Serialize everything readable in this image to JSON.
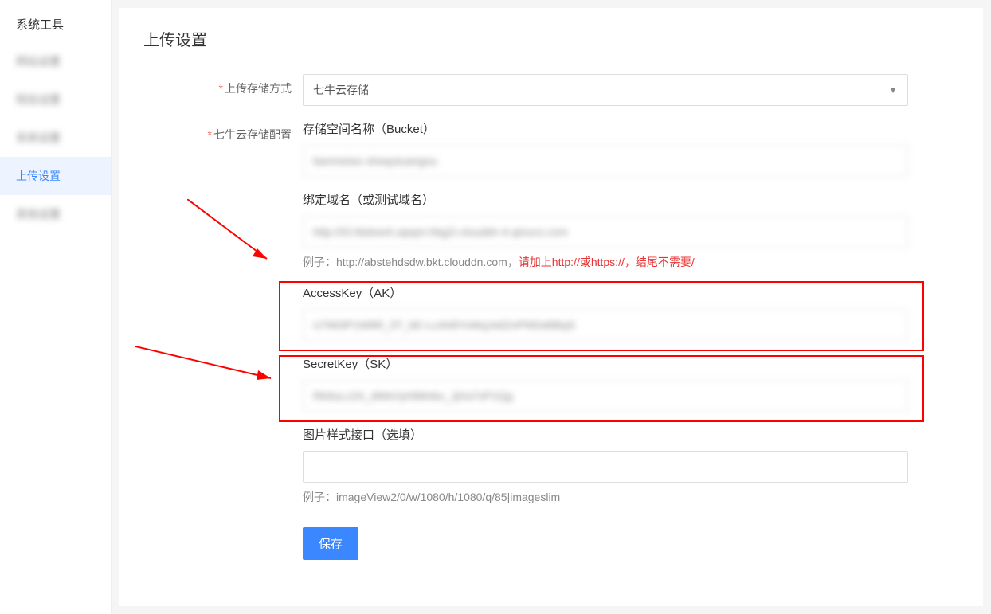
{
  "sidebar": {
    "header": "系统工具",
    "items": [
      {
        "label": "网站设置",
        "active": false,
        "blurred": true
      },
      {
        "label": "短信设置",
        "active": false,
        "blurred": true
      },
      {
        "label": "系统设置",
        "active": false,
        "blurred": true
      },
      {
        "label": "上传设置",
        "active": true,
        "blurred": false
      },
      {
        "label": "其他设置",
        "active": false,
        "blurred": true
      }
    ]
  },
  "page": {
    "title": "上传设置"
  },
  "form": {
    "storage_method_label": "上传存储方式",
    "storage_method_value": "七牛云存储",
    "qiniu_config_label": "七牛云存储配置",
    "bucket": {
      "label": "存储空间名称（Bucket）",
      "value": "tianmeiwo shequtuangou"
    },
    "domain": {
      "label": "绑定域名（或测试域名）",
      "value": "http://t3.hbdow4.uipqnr.hbg2i.clouddn-4.qinucs.com",
      "hint_prefix": "例子：http://abstehdsdw.bkt.clouddn.com，",
      "hint_danger": "请加上http://或https://，结尾不需要/"
    },
    "ak": {
      "label": "AccessKey（AK）",
      "value": "U7iM3P1W8R_5T_kE-LcAh8YvWqJx6ZnPf4Dd9BqS"
    },
    "sk": {
      "label": "SecretKey（SK）",
      "value": "Rk9uLc2A_dWeVyHtMnbv_JjXa7sP1Qg"
    },
    "style": {
      "label": "图片样式接口（选填）",
      "value": "",
      "hint": "例子：imageView2/0/w/1080/h/1080/q/85|imageslim"
    },
    "save_label": "保存"
  }
}
